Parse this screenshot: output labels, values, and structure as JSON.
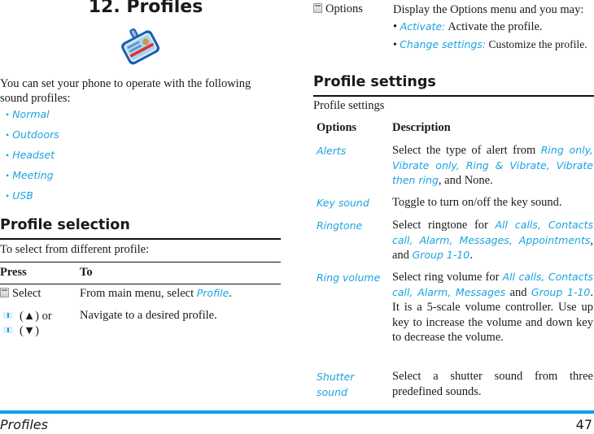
{
  "chapter": {
    "title": "12. Profiles",
    "icon": "profile-badge-icon"
  },
  "intro": {
    "text": "You can set your phone to operate with the following sound profiles:",
    "profiles": [
      "Normal",
      "Outdoors",
      "Headset",
      "Meeting",
      "USB"
    ]
  },
  "profile_selection": {
    "heading": "Profile selection",
    "intro": "To select from different profile:",
    "columns": [
      "Press",
      "To"
    ],
    "rows": [
      {
        "key_icon": "softkey-icon",
        "key": "Select",
        "desc_prefix": "From main menu, select ",
        "desc_link": "Profile",
        "desc_suffix": "."
      },
      {
        "key_icon": "nav-key-icon",
        "key_up": "(▲) or",
        "key_down": "(▼)",
        "desc": "Navigate to a desired profile."
      }
    ]
  },
  "options_row": {
    "key_icon": "softkey-icon",
    "key": "Options",
    "desc": "Display the Options menu and you may:",
    "items": [
      {
        "label": "Activate:",
        "text": " Activate the profile."
      },
      {
        "label": "Change settings:",
        "text": " Customize the profile."
      }
    ]
  },
  "profile_settings": {
    "heading": "Profile settings",
    "intro": "Profile settings",
    "columns": [
      "Options",
      "Description"
    ],
    "rows": [
      {
        "option": "Alerts",
        "parts": [
          {
            "t": "Select the type of alert from ",
            "link": false
          },
          {
            "t": "Ring only, Vibrate only, Ring & Vibrate, Vibrate then ring",
            "link": true
          },
          {
            "t": ", and None.",
            "link": false
          }
        ]
      },
      {
        "option": "Key sound",
        "parts": [
          {
            "t": "Toggle to turn on/off the key sound.",
            "link": false
          }
        ]
      },
      {
        "option": "Ringtone",
        "parts": [
          {
            "t": "Select ringtone for ",
            "link": false
          },
          {
            "t": "All calls, Contacts call, Alarm, Messages, Appointments",
            "link": true
          },
          {
            "t": ", and ",
            "link": false
          },
          {
            "t": "Group 1-10",
            "link": true
          },
          {
            "t": ".",
            "link": false
          }
        ]
      },
      {
        "option": "Ring volume",
        "parts": [
          {
            "t": "Select ring volume for ",
            "link": false
          },
          {
            "t": "All calls, Contacts call, Alarm, Messages",
            "link": true
          },
          {
            "t": " and ",
            "link": false
          },
          {
            "t": "Group 1-10",
            "link": true
          },
          {
            "t": ". It is a 5-scale volume controller. Use up key to increase the volume and down key to decrease the volume.",
            "link": false
          }
        ]
      },
      {
        "option": "Shutter sound",
        "parts": [
          {
            "t": "Select a shutter sound from three predefined sounds.",
            "link": false
          }
        ]
      }
    ]
  },
  "footer": {
    "section": "Profiles",
    "page": "47"
  },
  "colors": {
    "accent": "#1aa3e0",
    "footer_bar": "#00a0e6",
    "text": "#1a1a1a"
  }
}
